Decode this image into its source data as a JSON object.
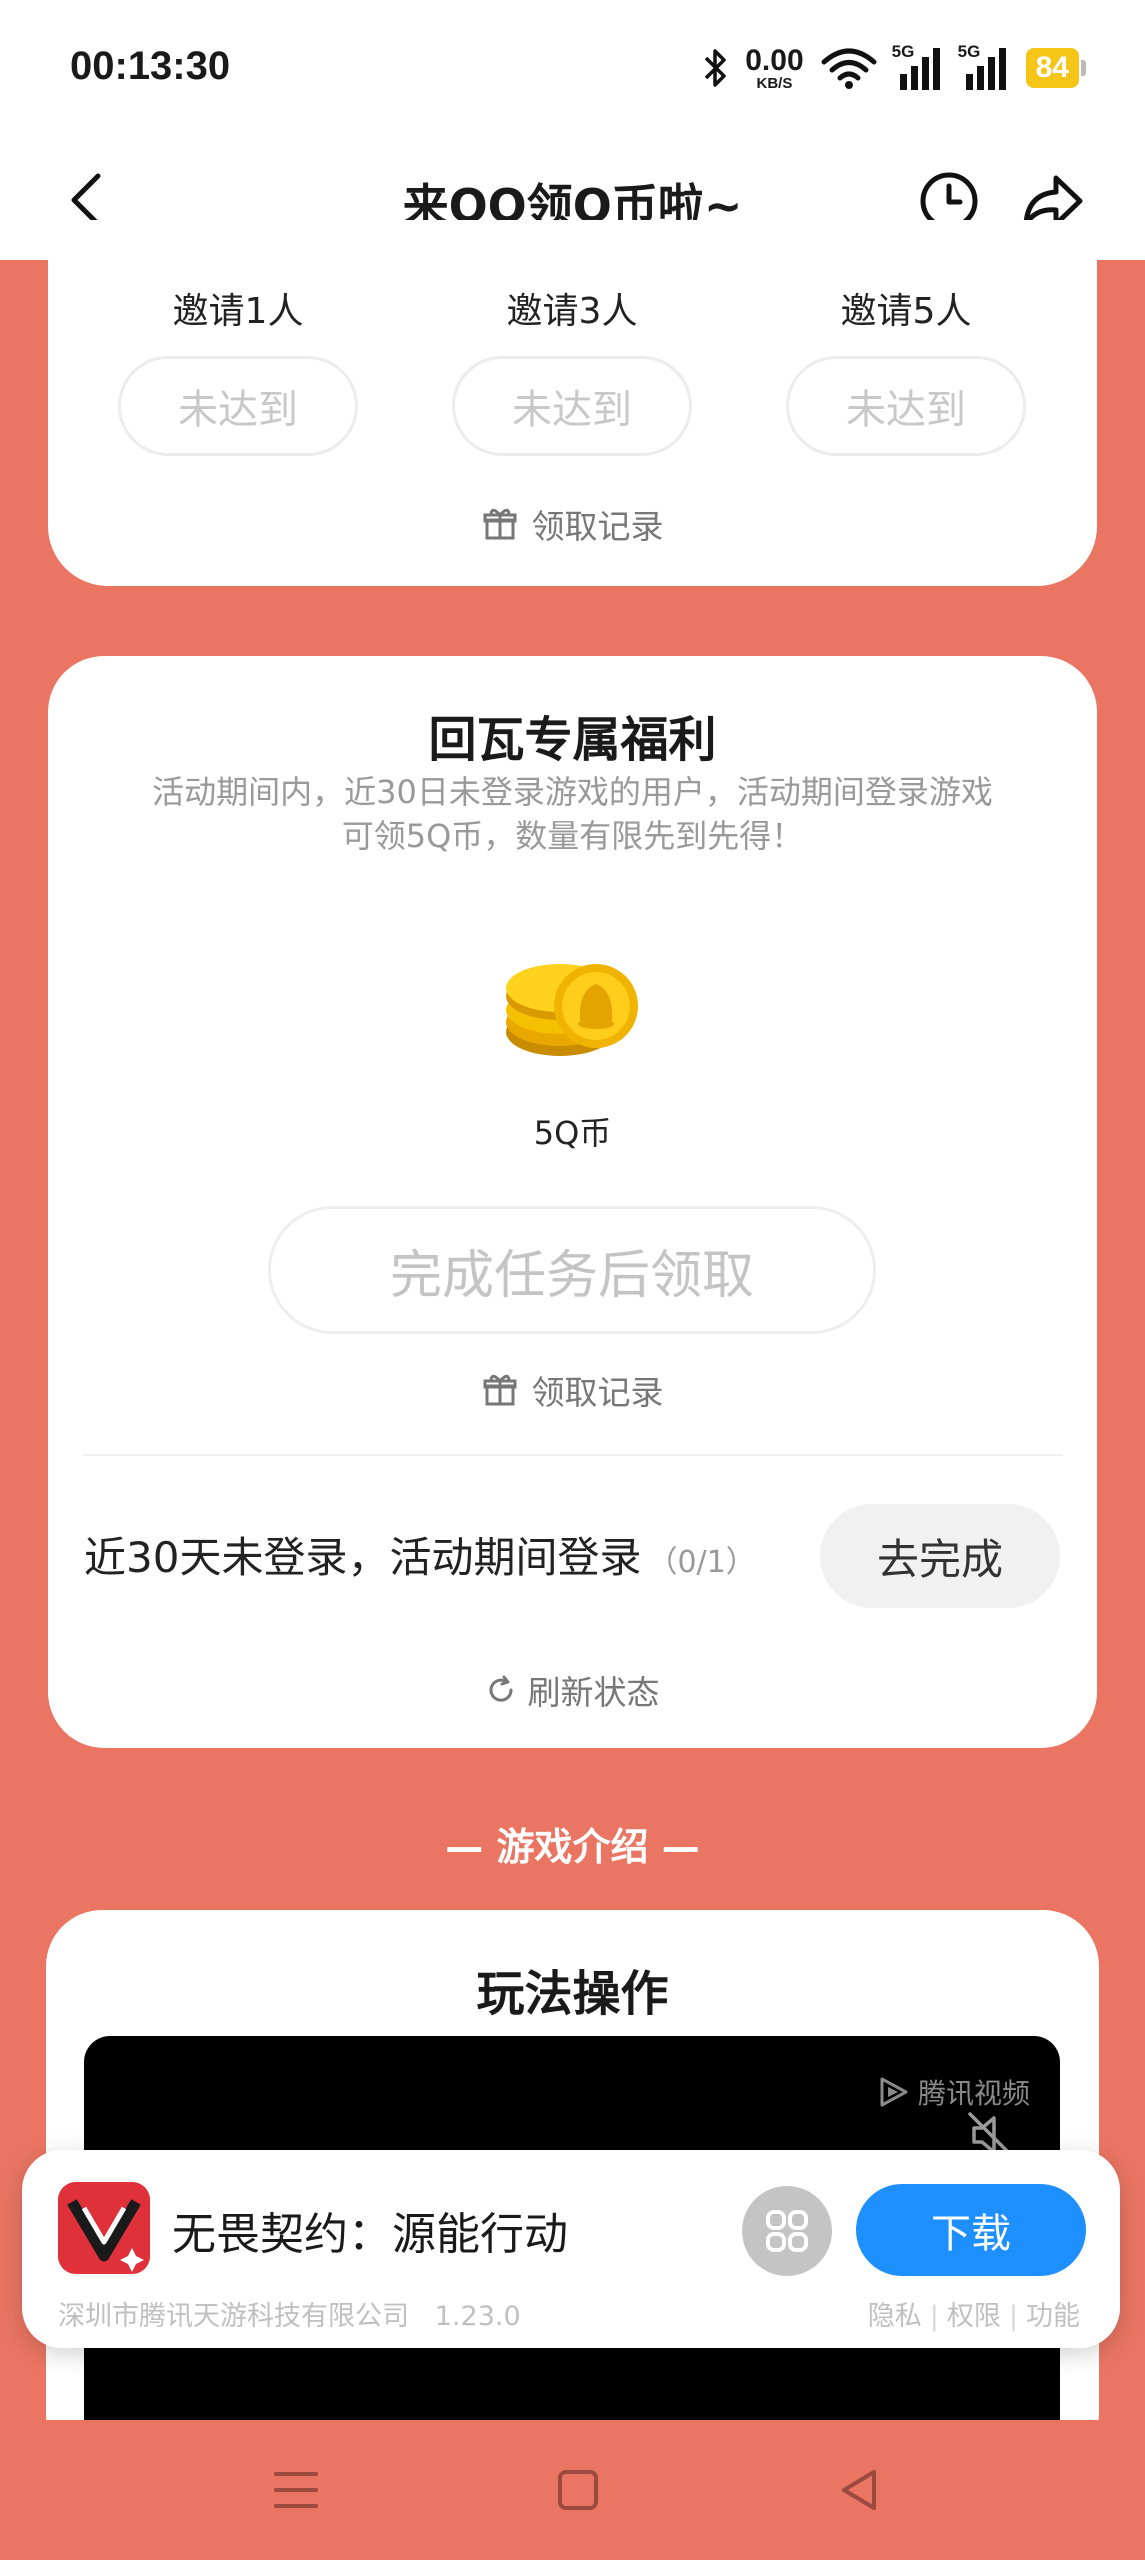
{
  "status_bar": {
    "time": "00:13:30",
    "net_speed_value": "0.00",
    "net_speed_unit": "KB/S",
    "signal1_label": "5G",
    "signal2_label": "5G",
    "battery": "84",
    "battery_color": "#f5c518"
  },
  "nav": {
    "title": "来QQ领Q币啦~",
    "back_icon": "chevron-left-icon",
    "history_icon": "clock-icon",
    "share_icon": "share-arrow-icon"
  },
  "invite_card": {
    "tiers": [
      {
        "label": "邀请1人",
        "button": "未达到"
      },
      {
        "label": "邀请3人",
        "button": "未达到"
      },
      {
        "label": "邀请5人",
        "button": "未达到"
      }
    ],
    "record_link": "领取记录"
  },
  "return_card": {
    "title": "回瓦专属福利",
    "description": "活动期间内，近30日未登录游戏的用户，活动期间登录游戏可领5Q币，数量有限先到先得！",
    "reward_label": "5Q币",
    "claim_button": "完成任务后领取",
    "record_link": "领取记录",
    "task_text": "近30天未登录，活动期间登录",
    "task_count": "（0/1）",
    "task_button": "去完成",
    "refresh_link": "刷新状态"
  },
  "section_title": "— 游戏介绍 —",
  "gameplay_card": {
    "title": "玩法操作",
    "video_brand": "腾讯视频"
  },
  "download_banner": {
    "app_name": "无畏契约：源能行动",
    "download_button": "下载",
    "company": "深圳市腾讯天游科技有限公司",
    "version": "1.23.0",
    "links": [
      "隐私",
      "权限",
      "功能"
    ],
    "accent_color": "#1e8fff"
  },
  "theme": {
    "background": "#ea7562"
  }
}
